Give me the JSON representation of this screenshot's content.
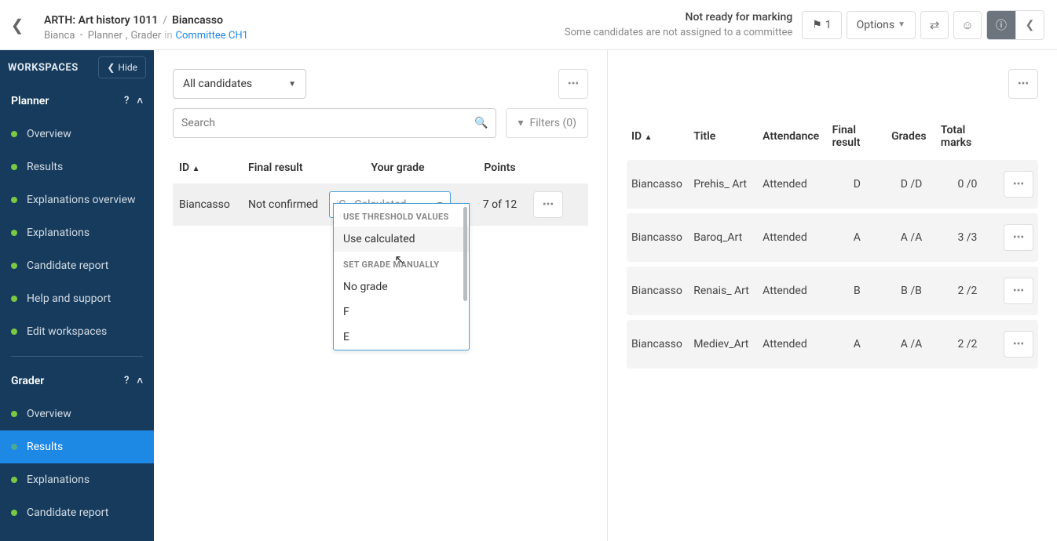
{
  "header": {
    "breadcrumb": {
      "course": "ARTH: Art history 1011",
      "candidate": "Biancasso"
    },
    "byline": {
      "name": "Bianca",
      "role1": "Planner",
      "role2": "Grader",
      "in_word": "in",
      "committee": "Committee CH1"
    },
    "status": {
      "main": "Not ready for marking",
      "sub": "Some candidates are not assigned to a committee"
    },
    "flag_count": "1",
    "options_label": "Options"
  },
  "sidebar": {
    "workspaces_label": "WORKSPACES",
    "hide_label": "Hide",
    "planner": {
      "title": "Planner",
      "items": [
        "Overview",
        "Results",
        "Explanations overview",
        "Explanations",
        "Candidate report",
        "Help and support",
        "Edit workspaces"
      ]
    },
    "grader": {
      "title": "Grader",
      "items": [
        "Overview",
        "Results",
        "Explanations",
        "Candidate report"
      ],
      "active_index": 1
    }
  },
  "left_panel": {
    "candidate_select": "All candidates",
    "search_placeholder": "Search",
    "filters_label": "Filters (0)",
    "columns": {
      "id": "ID",
      "final": "Final result",
      "grade": "Your grade",
      "points": "Points"
    },
    "row": {
      "id": "Biancasso",
      "final": "Not confirmed",
      "grade_display": "C - Calculated",
      "points": "7 of 12"
    },
    "dropdown": {
      "section1_label": "USE THRESHOLD VALUES",
      "opt_use_calculated": "Use calculated",
      "section2_label": "SET GRADE MANUALLY",
      "opt_no_grade": "No grade",
      "opt_f": "F",
      "opt_e": "E"
    }
  },
  "right_panel": {
    "columns": {
      "id": "ID",
      "title": "Title",
      "attendance": "Attendance",
      "final": "Final result",
      "grades": "Grades",
      "marks": "Total marks"
    },
    "rows": [
      {
        "id": "Biancasso",
        "title": "Prehis_ Art",
        "attendance": "Attended",
        "final": "D",
        "grades": "D /D",
        "marks": "0 /0"
      },
      {
        "id": "Biancasso",
        "title": "Baroq_Art",
        "attendance": "Attended",
        "final": "A",
        "grades": "A /A",
        "marks": "3 /3"
      },
      {
        "id": "Biancasso",
        "title": "Renais_ Art",
        "attendance": "Attended",
        "final": "B",
        "grades": "B /B",
        "marks": "2 /2"
      },
      {
        "id": "Biancasso",
        "title": "Mediev_Art",
        "attendance": "Attended",
        "final": "A",
        "grades": "A /A",
        "marks": "2 /2"
      }
    ]
  }
}
